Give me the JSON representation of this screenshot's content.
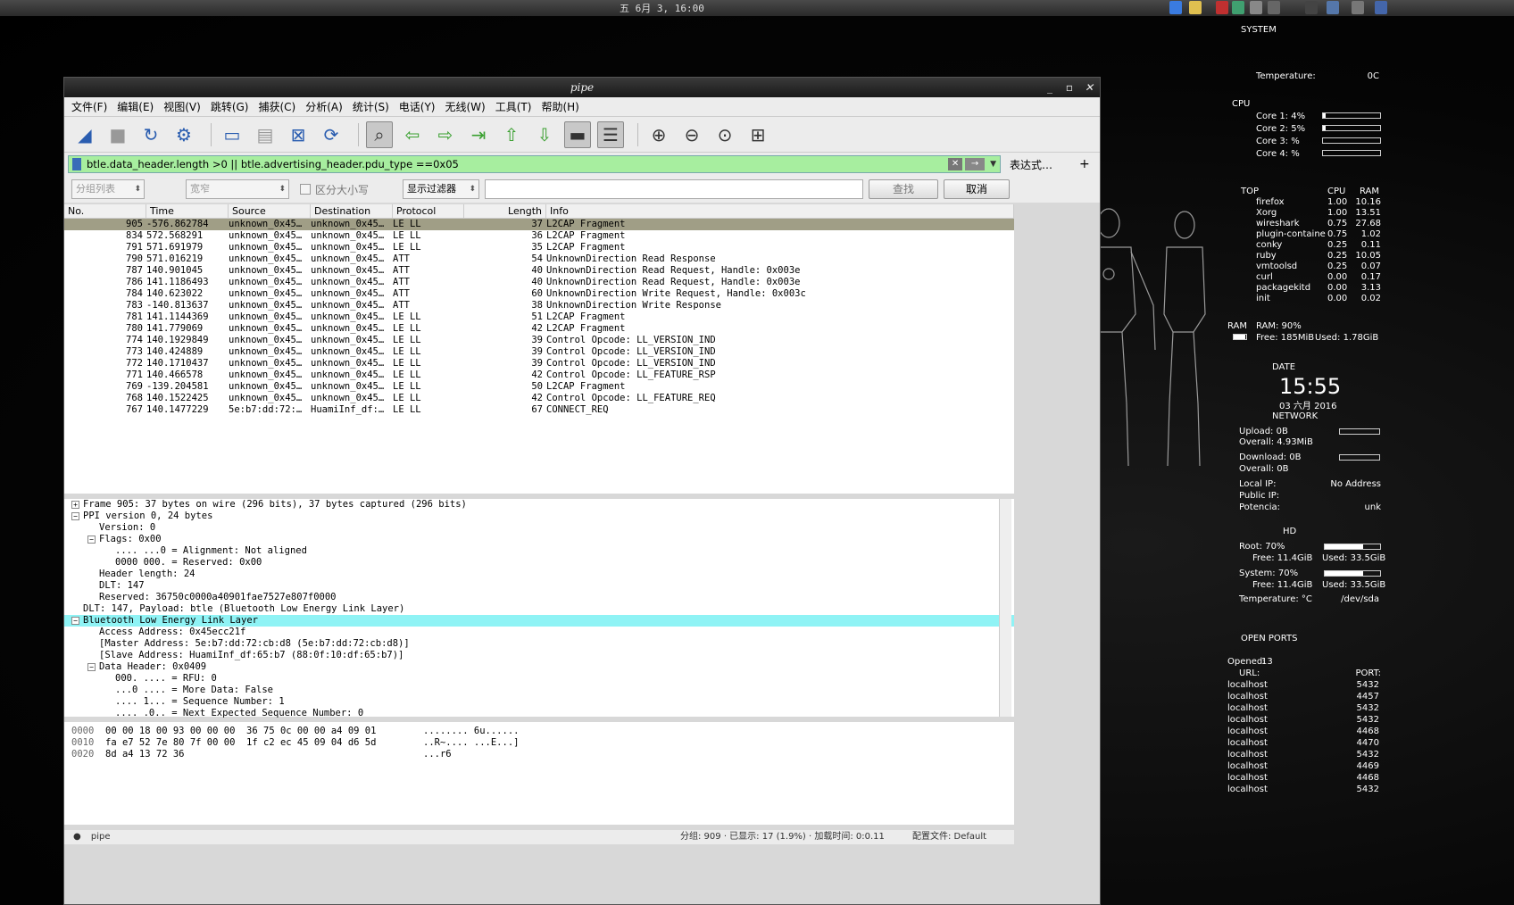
{
  "topbar": {
    "clock": "五 6月 3, 16:00"
  },
  "window": {
    "title": "pipe"
  },
  "menu": [
    "文件(F)",
    "编辑(E)",
    "视图(V)",
    "跳转(G)",
    "捕获(C)",
    "分析(A)",
    "统计(S)",
    "电话(Y)",
    "无线(W)",
    "工具(T)",
    "帮助(H)"
  ],
  "toolbar": {
    "icons": [
      "shark-fin-icon",
      "stop-icon",
      "restart-icon",
      "options-gear-icon",
      "open-folder-icon",
      "save-icon",
      "close-file-icon",
      "reload-icon",
      "find-icon",
      "back-arrow-icon",
      "forward-arrow-icon",
      "goto-packet-icon",
      "first-packet-icon",
      "last-packet-icon",
      "autoscroll-icon",
      "colorize-icon",
      "zoom-in-icon",
      "zoom-out-icon",
      "zoom-normal-icon",
      "resize-columns-icon"
    ]
  },
  "filter": {
    "value": "btle.data_header.length >0 || btle.advertising_header.pdu_type ==0x05",
    "expression_label": "表达式…",
    "plus": "+"
  },
  "find": {
    "scope": "分组列表",
    "width": "宽窄",
    "case_label": "区分大小写",
    "type": "显示过滤器",
    "search_value": "",
    "find_button": "查找",
    "cancel_button": "取消"
  },
  "columns": [
    "No.",
    "Time",
    "Source",
    "Destination",
    "Protocol",
    "Length",
    "Info"
  ],
  "packets": [
    {
      "no": "905",
      "time": "-576.862784",
      "src": "unknown_0x45…",
      "dst": "unknown_0x45…",
      "proto": "LE LL",
      "len": "37",
      "info": "L2CAP Fragment"
    },
    {
      "no": "834",
      "time": "572.568291",
      "src": "unknown_0x45…",
      "dst": "unknown_0x45…",
      "proto": "LE LL",
      "len": "36",
      "info": "L2CAP Fragment"
    },
    {
      "no": "791",
      "time": "571.691979",
      "src": "unknown_0x45…",
      "dst": "unknown_0x45…",
      "proto": "LE LL",
      "len": "35",
      "info": "L2CAP Fragment"
    },
    {
      "no": "790",
      "time": "571.016219",
      "src": "unknown_0x45…",
      "dst": "unknown_0x45…",
      "proto": "ATT",
      "len": "54",
      "info": "UnknownDirection Read Response"
    },
    {
      "no": "787",
      "time": "140.901045",
      "src": "unknown_0x45…",
      "dst": "unknown_0x45…",
      "proto": "ATT",
      "len": "40",
      "info": "UnknownDirection Read Request, Handle: 0x003e"
    },
    {
      "no": "786",
      "time": "141.1186493",
      "src": "unknown_0x45…",
      "dst": "unknown_0x45…",
      "proto": "ATT",
      "len": "40",
      "info": "UnknownDirection Read Request, Handle: 0x003e"
    },
    {
      "no": "784",
      "time": "140.623022",
      "src": "unknown_0x45…",
      "dst": "unknown_0x45…",
      "proto": "ATT",
      "len": "60",
      "info": "UnknownDirection Write Request, Handle: 0x003c"
    },
    {
      "no": "783",
      "time": "-140.813637",
      "src": "unknown_0x45…",
      "dst": "unknown_0x45…",
      "proto": "ATT",
      "len": "38",
      "info": "UnknownDirection Write Response"
    },
    {
      "no": "781",
      "time": "141.1144369",
      "src": "unknown_0x45…",
      "dst": "unknown_0x45…",
      "proto": "LE LL",
      "len": "51",
      "info": "L2CAP Fragment"
    },
    {
      "no": "780",
      "time": "141.779069",
      "src": "unknown_0x45…",
      "dst": "unknown_0x45…",
      "proto": "LE LL",
      "len": "42",
      "info": "L2CAP Fragment"
    },
    {
      "no": "774",
      "time": "140.1929849",
      "src": "unknown_0x45…",
      "dst": "unknown_0x45…",
      "proto": "LE LL",
      "len": "39",
      "info": "Control Opcode: LL_VERSION_IND"
    },
    {
      "no": "773",
      "time": "140.424889",
      "src": "unknown_0x45…",
      "dst": "unknown_0x45…",
      "proto": "LE LL",
      "len": "39",
      "info": "Control Opcode: LL_VERSION_IND"
    },
    {
      "no": "772",
      "time": "140.1710437",
      "src": "unknown_0x45…",
      "dst": "unknown_0x45…",
      "proto": "LE LL",
      "len": "39",
      "info": "Control Opcode: LL_VERSION_IND"
    },
    {
      "no": "771",
      "time": "140.466578",
      "src": "unknown_0x45…",
      "dst": "unknown_0x45…",
      "proto": "LE LL",
      "len": "42",
      "info": "Control Opcode: LL_FEATURE_RSP"
    },
    {
      "no": "769",
      "time": "-139.204581",
      "src": "unknown_0x45…",
      "dst": "unknown_0x45…",
      "proto": "LE LL",
      "len": "50",
      "info": "L2CAP Fragment"
    },
    {
      "no": "768",
      "time": "140.1522425",
      "src": "unknown_0x45…",
      "dst": "unknown_0x45…",
      "proto": "LE LL",
      "len": "42",
      "info": "Control Opcode: LL_FEATURE_REQ"
    },
    {
      "no": "767",
      "time": "140.1477229",
      "src": "5e:b7:dd:72:…",
      "dst": "HuamiInf_df:…",
      "proto": "LE LL",
      "len": "67",
      "info": "CONNECT_REQ"
    }
  ],
  "details": [
    {
      "indent": 0,
      "toggle": "+",
      "text": "Frame 905: 37 bytes on wire (296 bits), 37 bytes captured (296 bits)"
    },
    {
      "indent": 0,
      "toggle": "-",
      "text": "PPI version 0, 24 bytes"
    },
    {
      "indent": 1,
      "toggle": "",
      "text": "Version: 0"
    },
    {
      "indent": 1,
      "toggle": "-",
      "text": "Flags: 0x00"
    },
    {
      "indent": 2,
      "toggle": "",
      "text": ".... ...0 = Alignment: Not aligned"
    },
    {
      "indent": 2,
      "toggle": "",
      "text": "0000 000. = Reserved: 0x00"
    },
    {
      "indent": 1,
      "toggle": "",
      "text": "Header length: 24"
    },
    {
      "indent": 1,
      "toggle": "",
      "text": "DLT: 147"
    },
    {
      "indent": 1,
      "toggle": "",
      "text": "Reserved: 36750c0000a40901fae7527e807f0000"
    },
    {
      "indent": 0,
      "toggle": "",
      "text": "DLT: 147, Payload: btle (Bluetooth Low Energy Link Layer)"
    },
    {
      "indent": 0,
      "toggle": "-",
      "text": "Bluetooth Low Energy Link Layer",
      "hl": true
    },
    {
      "indent": 1,
      "toggle": "",
      "text": "Access Address: 0x45ecc21f"
    },
    {
      "indent": 1,
      "toggle": "",
      "text": "[Master Address: 5e:b7:dd:72:cb:d8 (5e:b7:dd:72:cb:d8)]"
    },
    {
      "indent": 1,
      "toggle": "",
      "text": "[Slave Address: HuamiInf_df:65:b7 (88:0f:10:df:65:b7)]"
    },
    {
      "indent": 1,
      "toggle": "-",
      "text": "Data Header: 0x0409"
    },
    {
      "indent": 2,
      "toggle": "",
      "text": "000. .... = RFU: 0"
    },
    {
      "indent": 2,
      "toggle": "",
      "text": "...0 .... = More Data: False"
    },
    {
      "indent": 2,
      "toggle": "",
      "text": ".... 1... = Sequence Number: 1"
    },
    {
      "indent": 2,
      "toggle": "",
      "text": ".... .0.. = Next Expected Sequence Number: 0"
    }
  ],
  "hex": [
    {
      "off": "0000",
      "bytes": "00 00 18 00 93 00 00 00  36 75 0c 00 00 a4 09 01",
      "ascii": "........ 6u......"
    },
    {
      "off": "0010",
      "bytes": "fa e7 52 7e 80 7f 00 00  1f c2 ec 45 09 04 d6 5d",
      "ascii": "..R~.... ...E...]"
    },
    {
      "off": "0020",
      "bytes": "8d a4 13 72 36",
      "ascii": "...r6"
    }
  ],
  "status": {
    "file": "pipe",
    "packets": "分组: 909 · 已显示: 17 (1.9%) · 加载时间: 0:0.11",
    "profile": "配置文件: Default"
  },
  "conky": {
    "system": "SYSTEM",
    "temperature_label": "Temperature:",
    "temperature_value": "0C",
    "cpu": "CPU",
    "cores": [
      {
        "label": "Core 1: 4%",
        "pct": 4
      },
      {
        "label": "Core 2: 5%",
        "pct": 5
      },
      {
        "label": "Core 3: %",
        "pct": 0
      },
      {
        "label": "Core 4: %",
        "pct": 0
      }
    ],
    "top": "TOP",
    "top_cpu": "CPU",
    "top_ram": "RAM",
    "procs": [
      {
        "n": "firefox",
        "c": "1.00",
        "r": "10.16"
      },
      {
        "n": "Xorg",
        "c": "1.00",
        "r": "13.51"
      },
      {
        "n": "wireshark",
        "c": "0.75",
        "r": "27.68"
      },
      {
        "n": "plugin-containe",
        "c": "0.75",
        "r": "1.02"
      },
      {
        "n": "conky",
        "c": "0.25",
        "r": "0.11"
      },
      {
        "n": "ruby",
        "c": "0.25",
        "r": "10.05"
      },
      {
        "n": "vmtoolsd",
        "c": "0.25",
        "r": "0.07"
      },
      {
        "n": "curl",
        "c": "0.00",
        "r": "0.17"
      },
      {
        "n": "packagekitd",
        "c": "0.00",
        "r": "3.13"
      },
      {
        "n": "init",
        "c": "0.00",
        "r": "0.02"
      }
    ],
    "ram_label": "RAM",
    "ram_pct_label": "RAM: 90%",
    "ram_free": "Free: 185MiB",
    "ram_used": "Used: 1.78GiB",
    "ram_pct": 90,
    "date_label": "DATE",
    "time": "15:55",
    "date": "03 六月 2016",
    "network": "NETWORK",
    "upload": "Upload: 0B",
    "overall_up": "Overall: 4.93MiB",
    "download": "Download: 0B",
    "overall_down": "Overall: 0B",
    "local_ip_label": "Local IP:",
    "local_ip": "No Address",
    "public_ip_label": "Public IP:",
    "potencia_label": "Potencia:",
    "potencia": "unk",
    "hd": "HD",
    "root": "Root: 70%",
    "root_free": "Free: 11.4GiB",
    "root_used": "Used: 33.5GiB",
    "root_pct": 70,
    "system_hd": "System: 70%",
    "sys_free": "Free: 11.4GiB",
    "sys_used": "Used: 33.5GiB",
    "sys_pct": 70,
    "hd_temp": "Temperature: °C",
    "hd_dev": "/dev/sda",
    "ports": "OPEN PORTS",
    "opened_label": "Opened:",
    "opened": "13",
    "url_label": "URL:",
    "port_label": "PORT:",
    "port_list": [
      {
        "h": "localhost",
        "p": "5432"
      },
      {
        "h": "localhost",
        "p": "4457"
      },
      {
        "h": "localhost",
        "p": "5432"
      },
      {
        "h": "localhost",
        "p": "5432"
      },
      {
        "h": "localhost",
        "p": "4468"
      },
      {
        "h": "localhost",
        "p": "4470"
      },
      {
        "h": "localhost",
        "p": "5432"
      },
      {
        "h": "localhost",
        "p": "4469"
      },
      {
        "h": "localhost",
        "p": "4468"
      },
      {
        "h": "localhost",
        "p": "5432"
      }
    ]
  }
}
